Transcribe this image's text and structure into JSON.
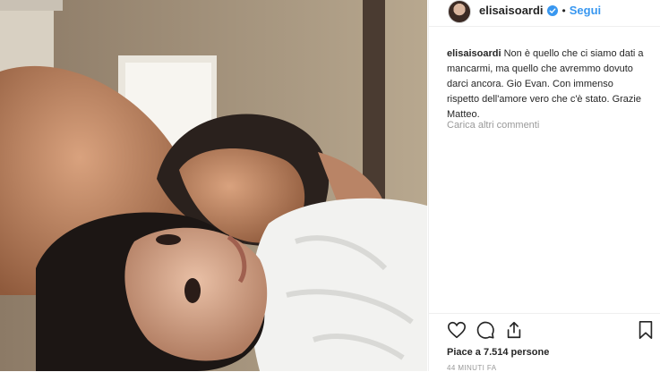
{
  "post": {
    "username": "elisaisoardi",
    "separator": "•",
    "follow_label": "Segui",
    "caption_user": "elisaisoardi",
    "caption_text": "Non è quello che ci siamo dati a mancarmi, ma quello che avremmo dovuto darci ancora. Gio Evan. Con immenso rispetto dell'amore vero che c'è stato. Grazie Matteo.",
    "load_more_label": "Carica altri commenti",
    "likes_text": "Piace a 7.514 persone",
    "timestamp": "44 MINUTI FA"
  },
  "icons": {
    "like": "heart-icon",
    "comment": "comment-icon",
    "share": "share-icon",
    "save": "bookmark-icon",
    "verified": "verified-badge-icon"
  },
  "colors": {
    "accent": "#3897f0",
    "text": "#262626",
    "muted": "#999999",
    "border": "#efefef"
  }
}
